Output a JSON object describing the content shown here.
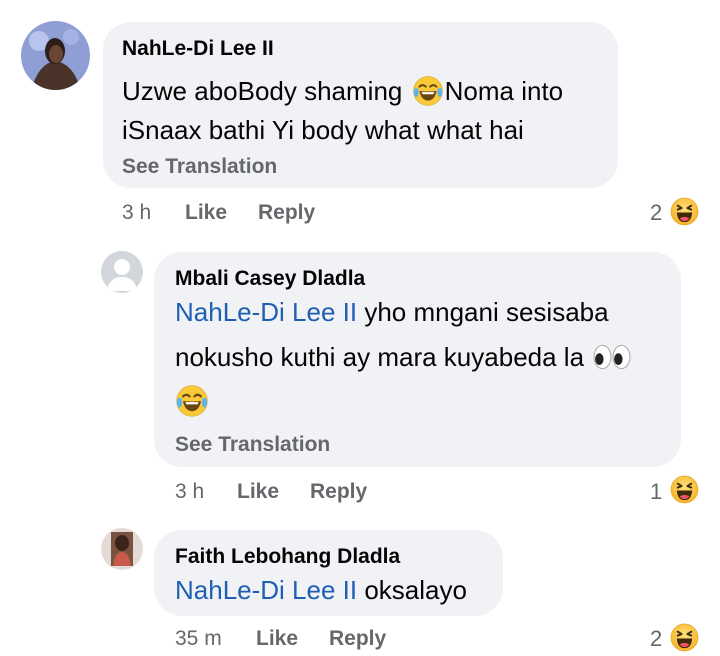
{
  "comments": [
    {
      "author": "NahLe-Di Lee II",
      "line1": "Uzwe aboBody shaming",
      "line1b": "Noma into",
      "line2": "iSnaax bathi Yi body what what hai",
      "see_translation": "See Translation",
      "time": "3 h",
      "like": "Like",
      "reply": "Reply",
      "reaction_count": "2",
      "reaction_icon": "haha-icon"
    },
    {
      "author": "Mbali Casey Dladla",
      "mention": "NahLe-Di Lee II",
      "line1": " yho mngani sesisaba",
      "line2": "nokusho kuthi ay mara kuyabeda la",
      "see_translation": "See Translation",
      "time": "3 h",
      "like": "Like",
      "reply": "Reply",
      "reaction_count": "1",
      "reaction_icon": "haha-icon"
    },
    {
      "author": "Faith Lebohang Dladla",
      "mention": "NahLe-Di Lee II",
      "line1": " oksalayo",
      "time": "35 m",
      "like": "Like",
      "reply": "Reply",
      "reaction_count": "2",
      "reaction_icon": "haha-icon"
    }
  ],
  "colors": {
    "bubble": "#f0f2f5",
    "mention": "#1f5fb3",
    "secondary_text": "#65676b",
    "haha": "#f7b125"
  }
}
